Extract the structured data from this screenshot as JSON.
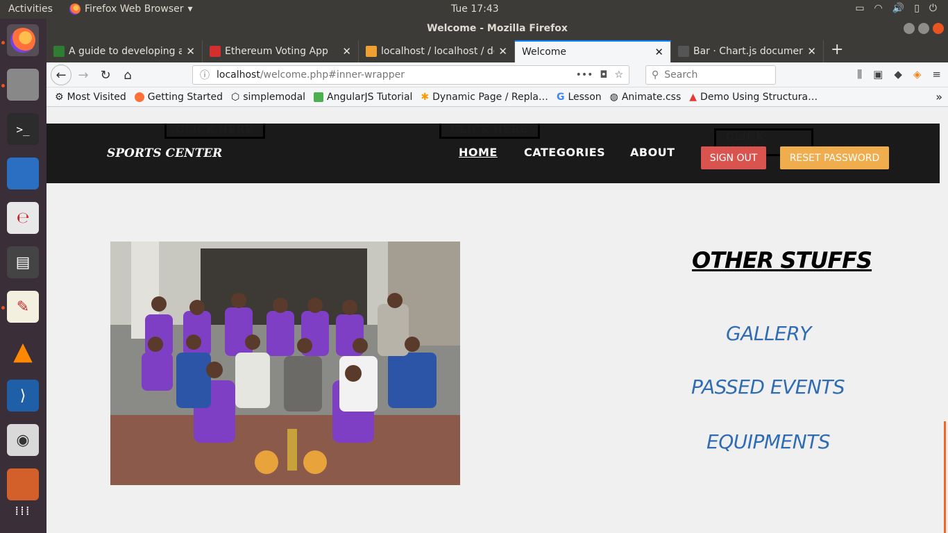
{
  "system": {
    "activities": "Activities",
    "app_name": "Firefox Web Browser",
    "clock": "Tue 17:43"
  },
  "window": {
    "title": "Welcome - Mozilla Firefox"
  },
  "tabs": [
    {
      "label": "A guide to developing an",
      "icon_color": "#2e7d32"
    },
    {
      "label": "Ethereum Voting App",
      "icon_color": "#d32f2f"
    },
    {
      "label": "localhost / localhost / de",
      "icon_color": "#f0a030"
    },
    {
      "label": "Welcome",
      "icon_color": "#ffffff"
    },
    {
      "label": "Bar · Chart.js documenta",
      "icon_color": "#555555"
    }
  ],
  "urlbar": {
    "host": "localhost",
    "path": "/welcome.php#inner-wrapper"
  },
  "search": {
    "placeholder": "Search"
  },
  "bookmarks": [
    {
      "label": "Most Visited",
      "icon_color": "#555555"
    },
    {
      "label": "Getting Started",
      "icon_color": "#ff7139"
    },
    {
      "label": "simplemodal",
      "icon_color": "#333333"
    },
    {
      "label": "AngularJS Tutorial",
      "icon_color": "#4caf50"
    },
    {
      "label": "Dynamic Page / Repla…",
      "icon_color": "#ff9800"
    },
    {
      "label": "Lesson",
      "icon_color": "#4285f4"
    },
    {
      "label": "Animate.css",
      "icon_color": "#555555"
    },
    {
      "label": "Demo Using Structura…",
      "icon_color": "#e53935"
    }
  ],
  "site": {
    "ghost_buttons": [
      "CLICK HERE",
      "CLICK HERE",
      "CLICK HERE"
    ],
    "brand": "SPORTS CENTER",
    "nav": {
      "home": "HOME",
      "categories": "CATEGORIES",
      "about": "ABOUT"
    },
    "sign_out": "SIGN OUT",
    "reset_password": "RESET PASSWORD",
    "sidebar": {
      "title": "OTHER STUFFS",
      "links": [
        "GALLERY",
        "PASSED EVENTS",
        "EQUIPMENTS"
      ]
    },
    "colors": {
      "header_bg": "#1a1a1a",
      "sign_out": "#d9534f",
      "reset_password": "#f0ad4e",
      "link": "#2f6cb3"
    }
  }
}
